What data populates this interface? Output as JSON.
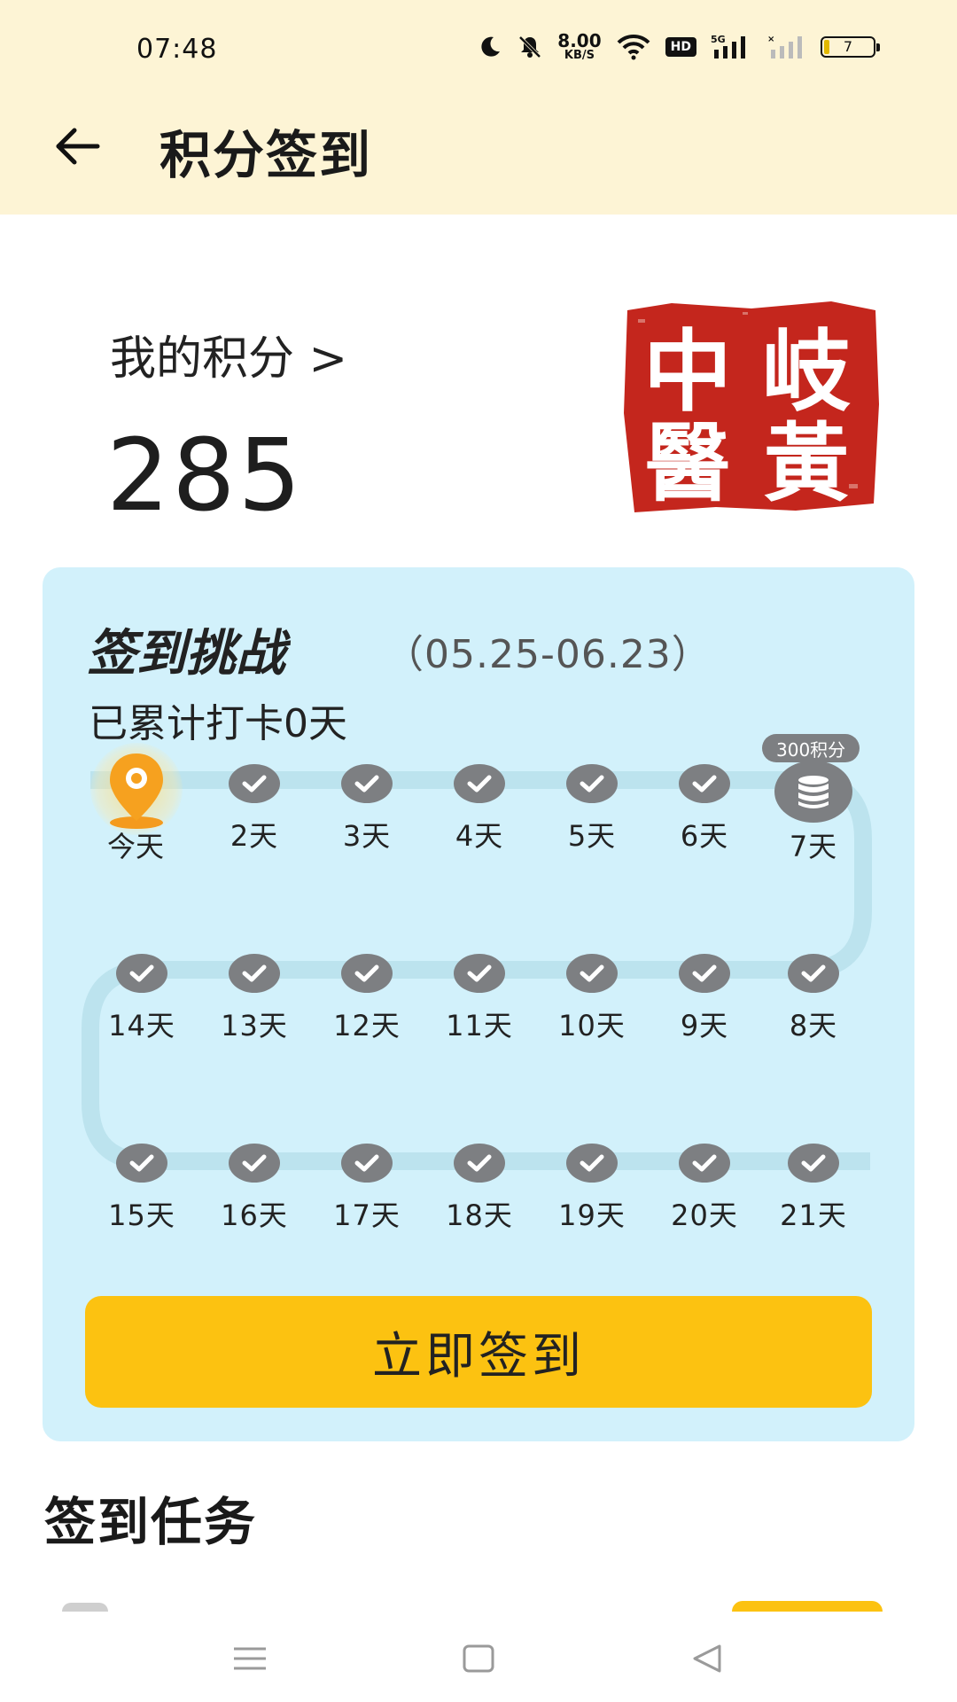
{
  "status_bar": {
    "time": "07:48",
    "net_speed_value": "8.00",
    "net_speed_unit": "KB/S",
    "hd_label": "HD",
    "network_label": "5G",
    "battery_level": "7",
    "icons": [
      "moon-icon",
      "mute-bell-icon",
      "wifi-icon",
      "hd-icon",
      "signal-5g-icon",
      "signal-2-icon",
      "battery-icon"
    ]
  },
  "header": {
    "title": "积分签到",
    "back_icon": "back-arrow-icon",
    "background": "#fdf4d5"
  },
  "points": {
    "link_label": "我的积分 >",
    "value": "285"
  },
  "seal": {
    "chars": [
      "中",
      "岐",
      "醫",
      "黃"
    ],
    "color": "#c4261d"
  },
  "challenge": {
    "title": "签到挑战",
    "date_range": "（05.25-06.23）",
    "summary": "已累计打卡0天",
    "reward_badge": "300积分",
    "today_label": "今天",
    "row1": [
      "2天",
      "3天",
      "4天",
      "5天",
      "6天",
      "7天"
    ],
    "row2": [
      "14天",
      "13天",
      "12天",
      "11天",
      "10天",
      "9天",
      "8天"
    ],
    "row3": [
      "15天",
      "16天",
      "17天",
      "18天",
      "19天",
      "20天",
      "21天"
    ],
    "button_label": "立即签到",
    "colors": {
      "card": "#d2f1fb",
      "button": "#fcc211",
      "check": "#7d7f82"
    }
  },
  "tasks": {
    "title": "签到任务"
  },
  "nav": {
    "icons": [
      "menu-icon",
      "home-square-icon",
      "back-triangle-icon"
    ]
  }
}
